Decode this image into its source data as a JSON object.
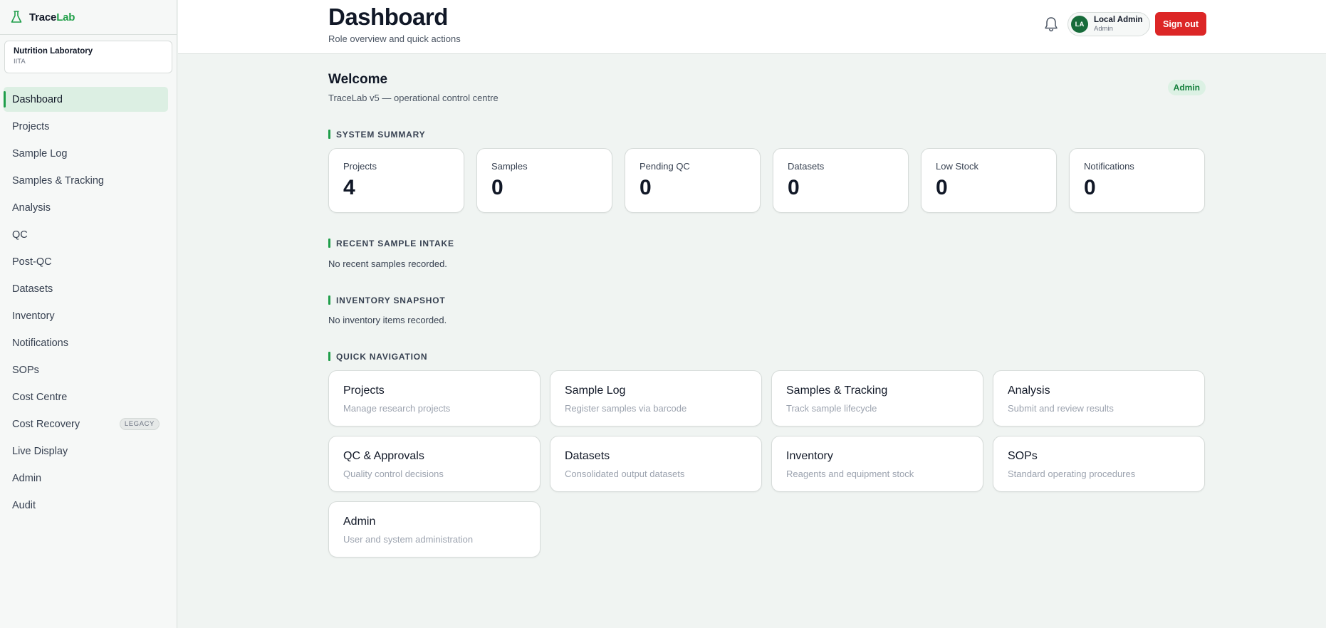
{
  "brand": {
    "part1": "Trace",
    "part2": "Lab"
  },
  "org": {
    "name": "Nutrition Laboratory",
    "sub": "IITA"
  },
  "sidebar": {
    "items": [
      {
        "label": "Dashboard"
      },
      {
        "label": "Projects"
      },
      {
        "label": "Sample Log"
      },
      {
        "label": "Samples & Tracking"
      },
      {
        "label": "Analysis"
      },
      {
        "label": "QC"
      },
      {
        "label": "Post-QC"
      },
      {
        "label": "Datasets"
      },
      {
        "label": "Inventory"
      },
      {
        "label": "Notifications"
      },
      {
        "label": "SOPs"
      },
      {
        "label": "Cost Centre"
      },
      {
        "label": "Cost Recovery",
        "badge": "LEGACY"
      },
      {
        "label": "Live Display"
      },
      {
        "label": "Admin"
      },
      {
        "label": "Audit"
      }
    ]
  },
  "header": {
    "title": "Dashboard",
    "subtitle": "Role overview and quick actions",
    "user": {
      "initials": "LA",
      "name": "Local Admin",
      "role": "Admin"
    },
    "signout_label": "Sign out"
  },
  "welcome": {
    "title": "Welcome",
    "subtitle": "TraceLab v5 — operational control centre",
    "role_badge": "Admin"
  },
  "summary": {
    "title": "SYSTEM SUMMARY",
    "stats": [
      {
        "label": "Projects",
        "value": "4"
      },
      {
        "label": "Samples",
        "value": "0"
      },
      {
        "label": "Pending QC",
        "value": "0"
      },
      {
        "label": "Datasets",
        "value": "0"
      },
      {
        "label": "Low Stock",
        "value": "0"
      },
      {
        "label": "Notifications",
        "value": "0"
      }
    ]
  },
  "recent": {
    "title": "RECENT SAMPLE INTAKE",
    "empty": "No recent samples recorded."
  },
  "inventory": {
    "title": "INVENTORY SNAPSHOT",
    "empty": "No inventory items recorded."
  },
  "quick": {
    "title": "QUICK NAVIGATION",
    "cards": [
      {
        "title": "Projects",
        "desc": "Manage research projects"
      },
      {
        "title": "Sample Log",
        "desc": "Register samples via barcode"
      },
      {
        "title": "Samples & Tracking",
        "desc": "Track sample lifecycle"
      },
      {
        "title": "Analysis",
        "desc": "Submit and review results"
      },
      {
        "title": "QC & Approvals",
        "desc": "Quality control decisions"
      },
      {
        "title": "Datasets",
        "desc": "Consolidated output datasets"
      },
      {
        "title": "Inventory",
        "desc": "Reagents and equipment stock"
      },
      {
        "title": "SOPs",
        "desc": "Standard operating procedures"
      },
      {
        "title": "Admin",
        "desc": "User and system administration"
      }
    ]
  },
  "colors": {
    "accent": "#1f9e4a",
    "danger": "#dc2626",
    "avatar": "#176b3a"
  },
  "icons": {
    "brand": "flask-icon",
    "notifications": "bell-icon"
  }
}
